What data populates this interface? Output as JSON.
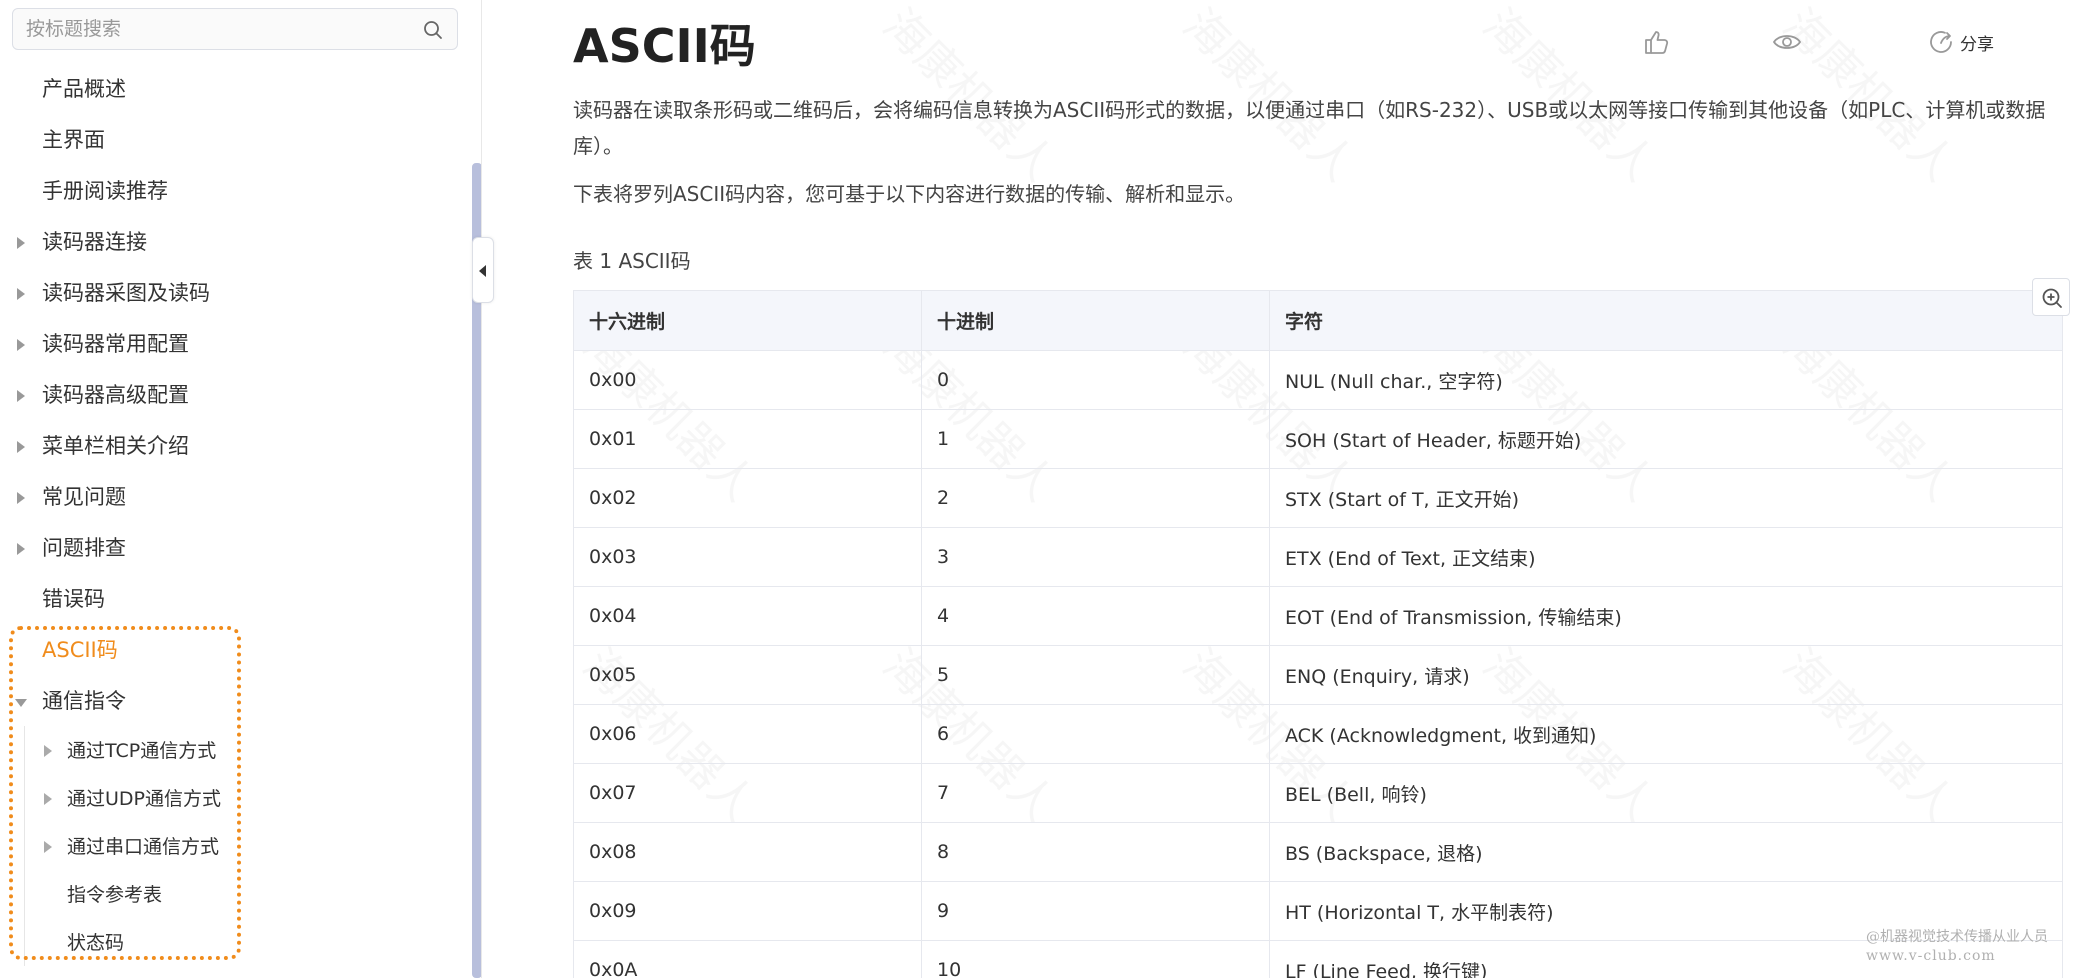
{
  "sidebar": {
    "search_placeholder": "按标题搜索",
    "items": [
      {
        "label": "产品概述",
        "caret": "none"
      },
      {
        "label": "主界面",
        "caret": "none"
      },
      {
        "label": "手册阅读推荐",
        "caret": "none"
      },
      {
        "label": "读码器连接",
        "caret": "collapsed"
      },
      {
        "label": "读码器采图及读码",
        "caret": "collapsed"
      },
      {
        "label": "读码器常用配置",
        "caret": "collapsed"
      },
      {
        "label": "读码器高级配置",
        "caret": "collapsed"
      },
      {
        "label": "菜单栏相关介绍",
        "caret": "collapsed"
      },
      {
        "label": "常见问题",
        "caret": "collapsed"
      },
      {
        "label": "问题排查",
        "caret": "collapsed"
      },
      {
        "label": "错误码",
        "caret": "none"
      },
      {
        "label": "ASCII码",
        "caret": "none",
        "active": true
      },
      {
        "label": "通信指令",
        "caret": "expanded"
      }
    ],
    "sub_items": [
      {
        "label": "通过TCP通信方式",
        "caret": "collapsed"
      },
      {
        "label": "通过UDP通信方式",
        "caret": "collapsed"
      },
      {
        "label": "通过串口通信方式",
        "caret": "collapsed"
      },
      {
        "label": "指令参考表",
        "caret": "none"
      },
      {
        "label": "状态码",
        "caret": "none"
      }
    ],
    "highlight_color": "#f08c1c"
  },
  "main": {
    "title": "ASCII码",
    "actions": {
      "like_icon": "thumbs-up-icon",
      "view_icon": "eye-icon",
      "share_icon": "share-icon",
      "share_label": "分享"
    },
    "paragraph1": "读码器在读取条形码或二维码后，会将编码信息转换为ASCII码形式的数据，以便通过串口（如RS-232）、USB或以太网等接口传输到其他设备（如PLC、计算机或数据库）。",
    "paragraph2": "下表将罗列ASCII码内容，您可基于以下内容进行数据的传输、解析和显示。",
    "table_caption": "表 1 ASCII码",
    "table": {
      "headers": [
        "十六进制",
        "十进制",
        "字符"
      ],
      "rows": [
        [
          "0x00",
          "0",
          "NUL (Null char., 空字符)"
        ],
        [
          "0x01",
          "1",
          "SOH (Start of Header, 标题开始)"
        ],
        [
          "0x02",
          "2",
          "STX (Start of T, 正文开始)"
        ],
        [
          "0x03",
          "3",
          "ETX (End of Text, 正文结束)"
        ],
        [
          "0x04",
          "4",
          "EOT (End of Transmission, 传输结束)"
        ],
        [
          "0x05",
          "5",
          "ENQ (Enquiry, 请求)"
        ],
        [
          "0x06",
          "6",
          "ACK (Acknowledgment, 收到通知)"
        ],
        [
          "0x07",
          "7",
          "BEL (Bell, 响铃)"
        ],
        [
          "0x08",
          "8",
          "BS (Backspace, 退格)"
        ],
        [
          "0x09",
          "9",
          "HT (Horizontal T, 水平制表符)"
        ],
        [
          "0x0A",
          "10",
          "LF (Line Feed, 换行键)"
        ]
      ]
    },
    "watermark_text": "海康机器人",
    "corner_line1": "@机器视觉技术传播从业人员",
    "corner_line2": "www.v-club.com"
  }
}
